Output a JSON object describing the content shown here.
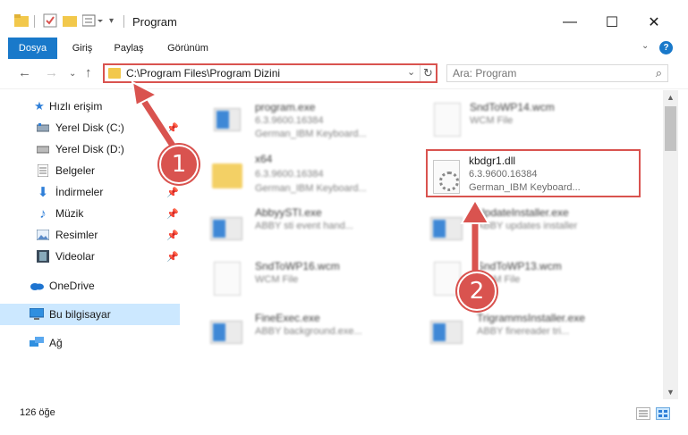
{
  "window": {
    "title": "Program",
    "minimize_glyph": "—",
    "maximize_glyph": "☐",
    "close_glyph": "✕"
  },
  "ribbon": {
    "tabs": [
      {
        "label": "Dosya",
        "active": true
      },
      {
        "label": "Giriş"
      },
      {
        "label": "Paylaş"
      },
      {
        "label": "Görünüm"
      }
    ],
    "help": "?"
  },
  "address": {
    "path": "C:\\Program Files\\Program Dizini",
    "search_placeholder": "Ara: Program"
  },
  "sidebar": {
    "items": [
      {
        "label": "Hızlı erişim",
        "icon": "star-icon"
      },
      {
        "label": "Yerel Disk (C:)",
        "icon": "drive-icon",
        "pinned": true
      },
      {
        "label": "Yerel Disk (D:)",
        "icon": "drive-icon"
      },
      {
        "label": "Belgeler",
        "icon": "documents-icon",
        "pinned": true
      },
      {
        "label": "İndirmeler",
        "icon": "download-icon",
        "pinned": true
      },
      {
        "label": "Müzik",
        "icon": "music-icon",
        "pinned": true
      },
      {
        "label": "Resimler",
        "icon": "pictures-icon",
        "pinned": true
      },
      {
        "label": "Videolar",
        "icon": "videos-icon",
        "pinned": true
      },
      {
        "label": "OneDrive",
        "icon": "cloud-icon"
      },
      {
        "label": "Bu bilgisayar",
        "icon": "computer-icon",
        "selected": true
      },
      {
        "label": "Ağ",
        "icon": "network-icon"
      }
    ]
  },
  "files": [
    {
      "name": "program.exe",
      "line1": "6.3.9600.16384",
      "line2": "German_IBM Keyboard...",
      "icon": "app-icon"
    },
    {
      "name": "SndToWP14.wcm",
      "line1": "WCM File",
      "line2": "",
      "icon": "file-icon"
    },
    {
      "name": "x64",
      "line1": "6.3.9600.16384",
      "line2": "German_IBM Keyboard...",
      "icon": "folder-icon"
    },
    {
      "name": "kbdgr1.dll",
      "line1": "6.3.9600.16384",
      "line2": "German_IBM Keyboard...",
      "icon": "dll-icon",
      "highlighted": true
    },
    {
      "name": "AbbyySTI.exe",
      "line1": "ABBY sti event hand...",
      "line2": "",
      "icon": "app-icon"
    },
    {
      "name": "UpdateInstaller.exe",
      "line1": "ABBY updates installer",
      "line2": "",
      "icon": "app-icon"
    },
    {
      "name": "SndToWP16.wcm",
      "line1": "WCM File",
      "line2": "",
      "icon": "file-icon"
    },
    {
      "name": "SndToWP13.wcm",
      "line1": "WCM File",
      "line2": "",
      "icon": "file-icon"
    },
    {
      "name": "FineExec.exe",
      "line1": "ABBY background.exe...",
      "line2": "",
      "icon": "app-icon"
    },
    {
      "name": "TrigrammsInstaller.exe",
      "line1": "ABBY finereader tri...",
      "line2": "",
      "icon": "app-icon"
    }
  ],
  "status": {
    "count": "126 öğe"
  },
  "annotations": {
    "badge1": "1",
    "badge2": "2",
    "color": "#d9534f"
  }
}
